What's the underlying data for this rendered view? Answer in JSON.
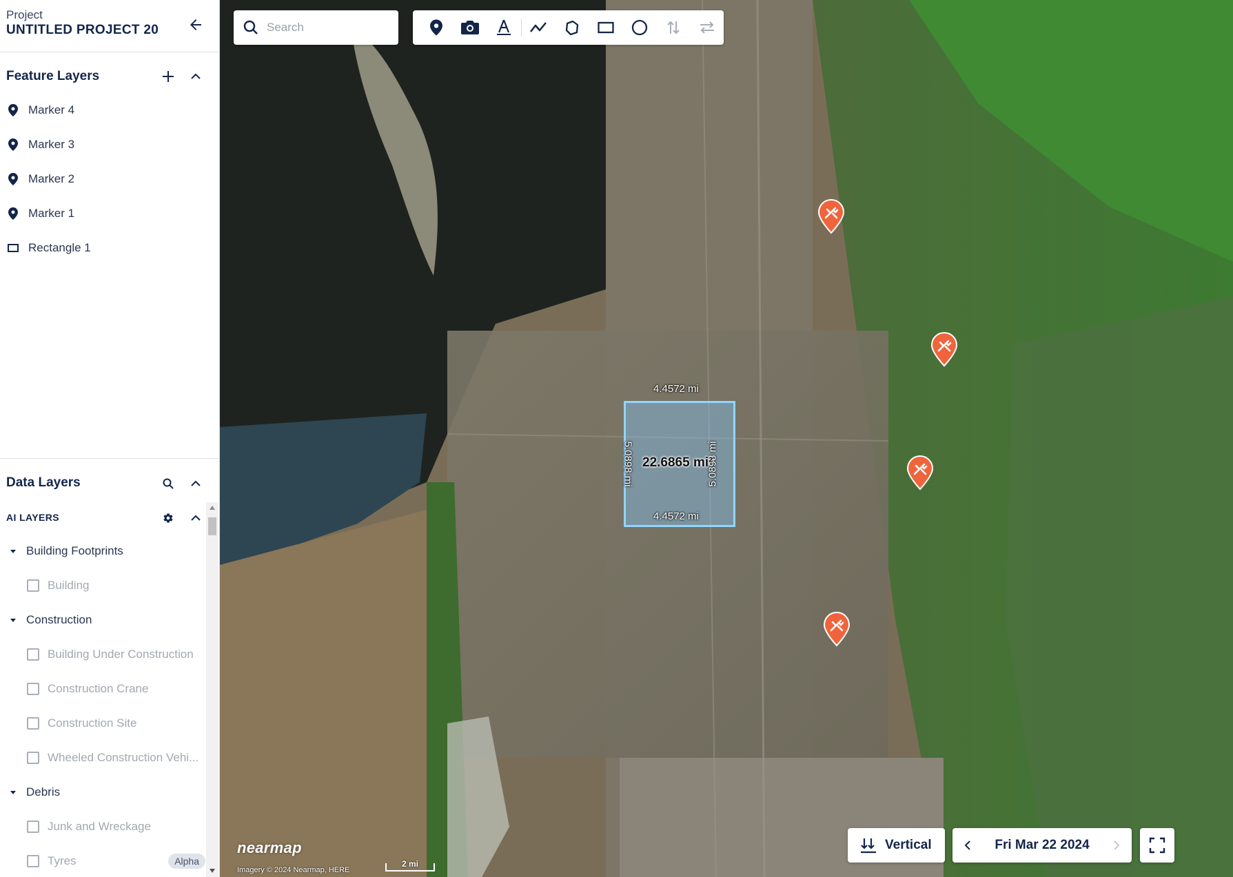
{
  "project": {
    "label": "Project",
    "name": "UNTITLED PROJECT 20"
  },
  "feature_layers": {
    "title": "Feature Layers",
    "items": [
      {
        "label": "Marker 4",
        "icon": "marker-icon"
      },
      {
        "label": "Marker 3",
        "icon": "marker-icon"
      },
      {
        "label": "Marker 2",
        "icon": "marker-icon"
      },
      {
        "label": "Marker 1",
        "icon": "marker-icon"
      },
      {
        "label": "Rectangle 1",
        "icon": "rectangle-icon"
      }
    ]
  },
  "data_layers": {
    "title": "Data Layers",
    "ai_layers_title": "AI LAYERS",
    "groups": [
      {
        "label": "Building Footprints",
        "items": [
          "Building"
        ]
      },
      {
        "label": "Construction",
        "items": [
          "Building Under Construction",
          "Construction Crane",
          "Construction Site",
          "Wheeled Construction Vehi..."
        ]
      },
      {
        "label": "Debris",
        "items": [
          "Junk and Wreckage",
          "Tyres"
        ]
      }
    ],
    "tyres_badge": "Alpha"
  },
  "search": {
    "placeholder": "Search"
  },
  "toolbar": {
    "tools": [
      "marker-tool",
      "camera-tool",
      "text-tool",
      "line-tool",
      "polygon-tool",
      "rectangle-tool",
      "circle-tool",
      "swap-vertical-tool",
      "swap-horizontal-tool"
    ]
  },
  "measurement": {
    "top": "4.4572 mi",
    "bottom": "4.4572 mi",
    "left": "5.0898 mi",
    "right": "5.0898 mi",
    "area": "22.6865 mi²"
  },
  "map": {
    "logo": "nearmap",
    "credit": "Imagery © 2024 Nearmap, HERE",
    "scale": "2 mi",
    "view_mode": "Vertical",
    "date": "Fri Mar 22 2024"
  },
  "colors": {
    "accent": "#13254a",
    "pin": "#f0643c",
    "rect_border": "#8fd6ff"
  }
}
